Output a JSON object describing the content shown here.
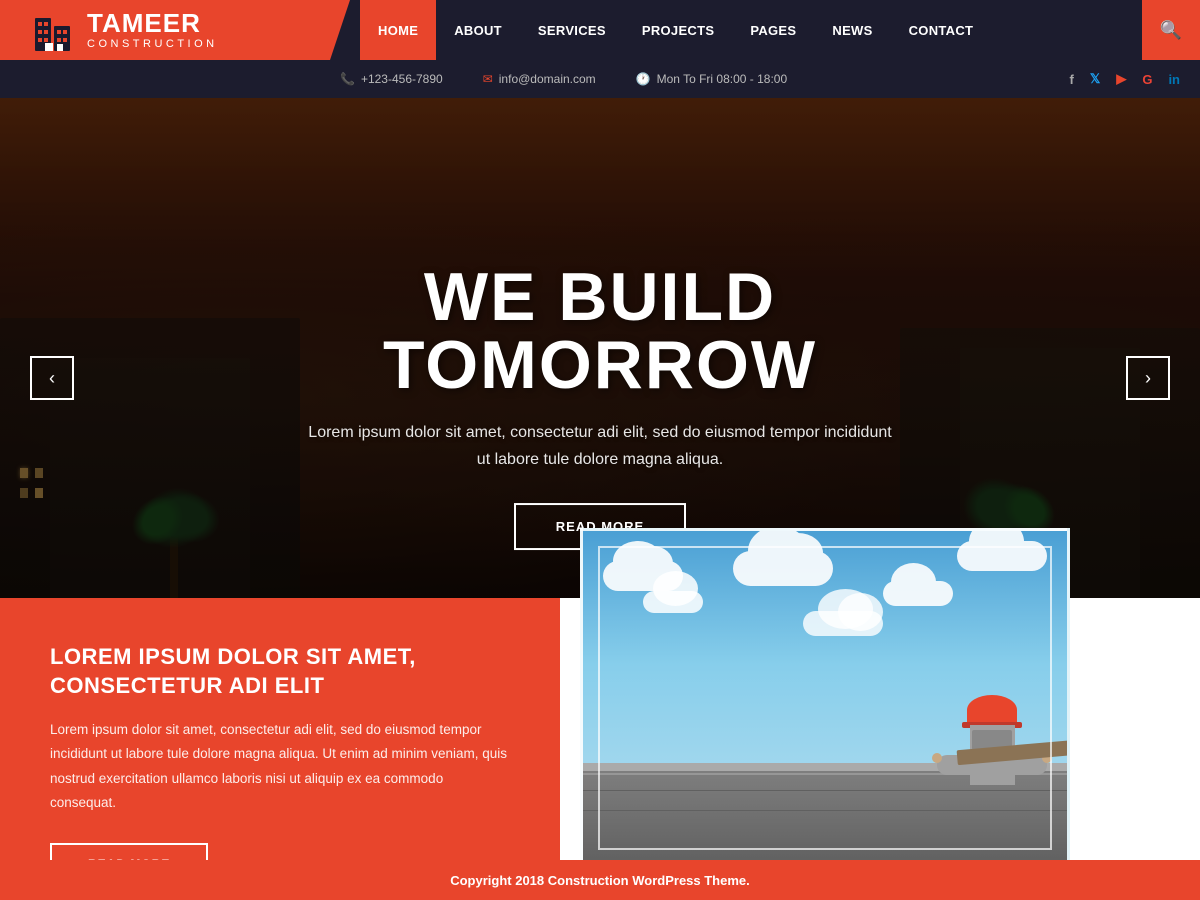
{
  "brand": {
    "name": "TAMEER",
    "tagline": "CONSTRUCTION"
  },
  "topbar": {
    "phone": "+123-456-7890",
    "email": "info@domain.com",
    "hours": "Mon To Fri 08:00 - 18:00"
  },
  "nav": {
    "items": [
      {
        "label": "HOME",
        "active": true
      },
      {
        "label": "ABOUT",
        "active": false
      },
      {
        "label": "SERVICES",
        "active": false
      },
      {
        "label": "PROJECTS",
        "active": false
      },
      {
        "label": "PAGES",
        "active": false
      },
      {
        "label": "NEWS",
        "active": false
      },
      {
        "label": "CONTACT",
        "active": false
      }
    ]
  },
  "hero": {
    "title": "WE BUILD TOMORROW",
    "description": "Lorem ipsum dolor sit amet, consectetur adi elit, sed do eiusmod tempor incididunt\nut labore tule dolore magna aliqua.",
    "button_label": "READ MORE",
    "arrow_left": "‹",
    "arrow_right": "›"
  },
  "content": {
    "left": {
      "title": "LOREM IPSUM DOLOR SIT AMET, CONSECTETUR ADI ELIT",
      "description": "Lorem ipsum dolor sit amet, consectetur adi elit, sed do eiusmod tempor incididunt ut labore tule dolore magna aliqua. Ut enim ad minim veniam, quis nostrud exercitation ullamco laboris nisi ut aliquip ex ea commodo consequat.",
      "button_label": "READ MORE"
    }
  },
  "footer": {
    "copyright": "Copyright 2018 Construction WordPress Theme."
  },
  "colors": {
    "accent": "#e8452c",
    "dark": "#1c1c2e",
    "white": "#ffffff"
  }
}
